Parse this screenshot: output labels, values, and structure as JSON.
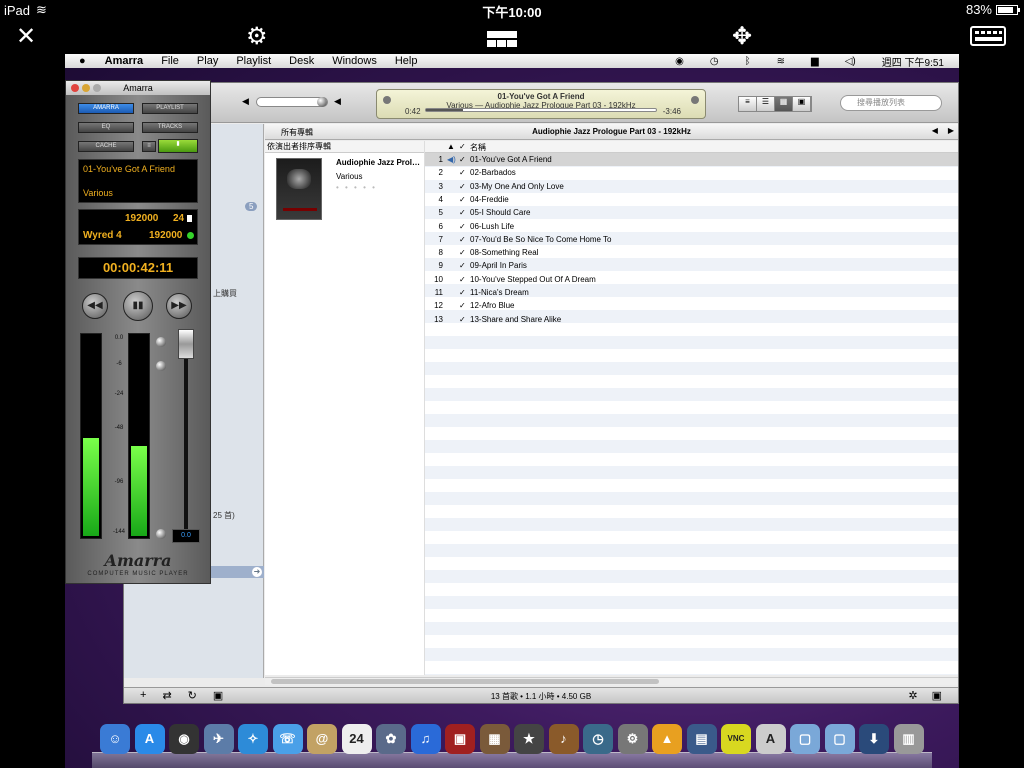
{
  "ipad": {
    "device": "iPad",
    "time": "下午10:00",
    "battery": "83%",
    "battery_level": 0.83
  },
  "vnc": {
    "close": "✕",
    "settings": "⚙",
    "move": "✥"
  },
  "menubar": {
    "app": "Amarra",
    "items": [
      "File",
      "Play",
      "Playlist",
      "Desk",
      "Windows",
      "Help"
    ],
    "clock": "週四 下午9:51"
  },
  "now_playing": {
    "title": "01-You've Got A Friend",
    "subtitle": "Various — Audiophie Jazz Prologue Part 03 - 192kHz",
    "elapsed": "0:42",
    "remaining": "-3:46",
    "progress": 0.16
  },
  "search": {
    "placeholder": "搜尋播放列表"
  },
  "sidebar": {
    "badge": "5",
    "frag1": "上購買",
    "frag2": "25 首)"
  },
  "albumbar": {
    "all": "所有專輯",
    "title": "Audiophie Jazz Prologue Part 03 - 192kHz"
  },
  "album": {
    "header": "依演出者排序專輯",
    "name": "Audiophie Jazz Prol…",
    "artist": "Various",
    "stars": "• • • • •"
  },
  "tracks_header": {
    "name": "名稱"
  },
  "tracks": [
    {
      "num": "1",
      "name": "01-You've Got A Friend"
    },
    {
      "num": "2",
      "name": "02-Barbados"
    },
    {
      "num": "3",
      "name": "03-My One And Only Love"
    },
    {
      "num": "4",
      "name": "04-Freddie"
    },
    {
      "num": "5",
      "name": "05-I Should Care"
    },
    {
      "num": "6",
      "name": "06-Lush Life"
    },
    {
      "num": "7",
      "name": "07-You'd Be So Nice To Come Home To"
    },
    {
      "num": "8",
      "name": "08-Something Real"
    },
    {
      "num": "9",
      "name": "09-April In Paris"
    },
    {
      "num": "10",
      "name": "10-You've Stepped Out Of A Dream"
    },
    {
      "num": "11",
      "name": "11-Nica's Dream"
    },
    {
      "num": "12",
      "name": "12-Afro Blue"
    },
    {
      "num": "13",
      "name": "13-Share and Share Alike"
    }
  ],
  "status": "13 首歌 • 1.1 小時 • 4.50 GB",
  "amarra": {
    "window_title": "Amarra",
    "btn_amarra": "AMARRA",
    "btn_playlist": "PLAYLIST",
    "btn_eq": "EQ",
    "btn_tracks": "TRACKS",
    "btn_cache": "CACHE",
    "track": "01-You've Got A Friend",
    "artist": "Various",
    "samplerate": "192000",
    "bits": "24",
    "device": "Wyred 4",
    "device_rate": "192000",
    "time": "00:00:42:11",
    "scale": [
      "0.0",
      "-6",
      "-24",
      "-48",
      "-96",
      "-144"
    ],
    "meter_left": 0.48,
    "meter_right": 0.44,
    "volume_value": "0.0",
    "logo": "Amarra",
    "subtitle": "COMPUTER MUSIC PLAYER"
  },
  "dock_icons": [
    {
      "name": "finder-icon",
      "color": "#3a7bd5",
      "glyph": "☺"
    },
    {
      "name": "app-store-icon",
      "color": "#2a8ae8",
      "glyph": "A"
    },
    {
      "name": "dashboard-icon",
      "color": "#333333",
      "glyph": "◉"
    },
    {
      "name": "mail-icon",
      "color": "#5c7ca8",
      "glyph": "✈"
    },
    {
      "name": "safari-icon",
      "color": "#2d8bd8",
      "glyph": "✧"
    },
    {
      "name": "ichat-icon",
      "color": "#4aa0e8",
      "glyph": "☏"
    },
    {
      "name": "address-book-icon",
      "color": "#c2a264",
      "glyph": "@"
    },
    {
      "name": "ical-icon",
      "color": "#eeeeee",
      "glyph": "24"
    },
    {
      "name": "iphoto-icon",
      "color": "#5a6a8a",
      "glyph": "✿"
    },
    {
      "name": "itunes-icon",
      "color": "#2a6ad8",
      "glyph": "♫"
    },
    {
      "name": "front-row-icon",
      "color": "#a02020",
      "glyph": "▣"
    },
    {
      "name": "photo-booth-icon",
      "color": "#7a5a3a",
      "glyph": "▦"
    },
    {
      "name": "imovie-icon",
      "color": "#444444",
      "glyph": "★"
    },
    {
      "name": "garageband-icon",
      "color": "#8a5a2a",
      "glyph": "♪"
    },
    {
      "name": "time-machine-icon",
      "color": "#3a6a8a",
      "glyph": "◷"
    },
    {
      "name": "system-preferences-icon",
      "color": "#777777",
      "glyph": "⚙"
    },
    {
      "name": "vlc-icon",
      "color": "#e8a020",
      "glyph": "▲"
    },
    {
      "name": "directory-utility-icon",
      "color": "#3a5a8a",
      "glyph": "▤"
    },
    {
      "name": "vnc-server-icon",
      "color": "#d8d820",
      "glyph": "VNC"
    },
    {
      "name": "amarra-icon",
      "color": "#cccccc",
      "glyph": "A"
    },
    {
      "name": "applications-folder-icon",
      "color": "#7aa8d8",
      "glyph": "▢"
    },
    {
      "name": "documents-folder-icon",
      "color": "#7aa8d8",
      "glyph": "▢"
    },
    {
      "name": "downloads-folder-icon",
      "color": "#2a4a7a",
      "glyph": "⬇"
    },
    {
      "name": "trash-icon",
      "color": "#999999",
      "glyph": "▥"
    }
  ]
}
